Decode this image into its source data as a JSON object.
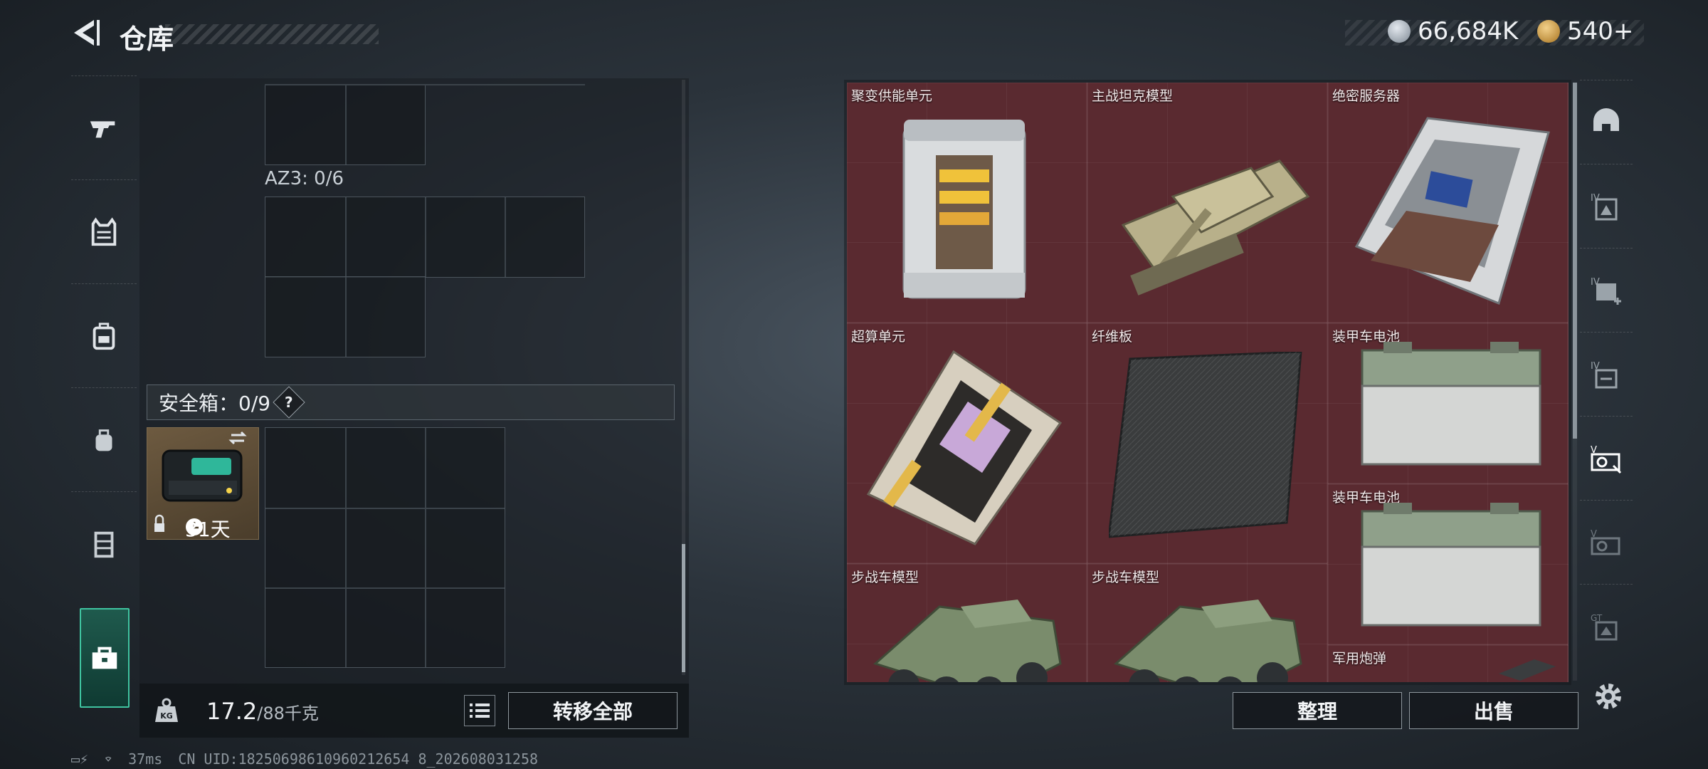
{
  "header": {
    "title": "仓库",
    "currency_a": "66,684K",
    "currency_b": "540+",
    "colors": {
      "currency_a": "#b9c2cc",
      "currency_b": "#d7a54a"
    }
  },
  "left_rail": {
    "icons": [
      "gun-icon",
      "vest-icon",
      "backpack-icon",
      "bag-icon",
      "chest-rig-icon",
      "safebox-icon"
    ],
    "active": "safebox-icon"
  },
  "left_panel": {
    "az3_label": "AZ3: 0/6",
    "safebox_label": "安全箱：0/9",
    "safebox_help": "?",
    "safebox_days": "31天"
  },
  "weight": {
    "current": "17.2",
    "max": "/88千克"
  },
  "buttons": {
    "transfer_all": "转移全部",
    "sort": "整理",
    "sell": "出售"
  },
  "items": [
    {
      "name": "聚变供能单元",
      "icon": "fusion-power-unit"
    },
    {
      "name": "主战坦克模型",
      "icon": "tank-model"
    },
    {
      "name": "绝密服务器",
      "icon": "server"
    },
    {
      "name": "超算单元",
      "icon": "supercomputing-unit"
    },
    {
      "name": "纤维板",
      "icon": "fiber-board"
    },
    {
      "name": "装甲车电池",
      "icon": "armored-battery"
    },
    {
      "name": "装甲车电池",
      "icon": "armored-battery"
    },
    {
      "name": "步战车模型",
      "icon": "ifv-model"
    },
    {
      "name": "步战车模型",
      "icon": "ifv-model"
    },
    {
      "name": "军用炮弹",
      "icon": "artillery-shell"
    }
  ],
  "right_rail": {
    "icons": [
      "helmet-icon",
      "armor-iv-icon",
      "armor-iv-plus-icon",
      "armor-iv-box-icon",
      "armor-v-vision-icon",
      "armor-v-icon",
      "armor-gt-icon"
    ],
    "labels": [
      "IV",
      "IV",
      "IV",
      "V",
      "V",
      "GT"
    ]
  },
  "footer": {
    "ping": "37ms",
    "uid": "CN UID:18250698610960212654 8_202608031258"
  }
}
